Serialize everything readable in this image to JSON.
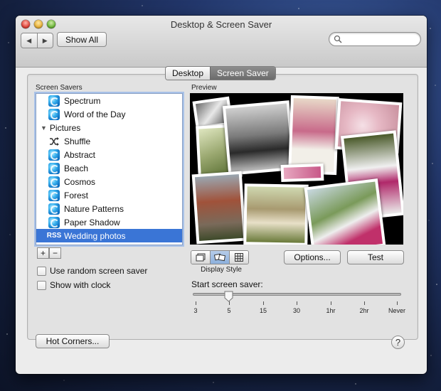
{
  "window": {
    "title": "Desktop & Screen Saver"
  },
  "toolbar": {
    "back": "◀",
    "forward": "▶",
    "show_all": "Show All",
    "search_placeholder": ""
  },
  "tabs": [
    {
      "label": "Desktop"
    },
    {
      "label": "Screen Saver",
      "selected": true
    }
  ],
  "screen_savers": {
    "label": "Screen Savers",
    "items": [
      {
        "label": "Spectrum",
        "icon": "screensaver-icon"
      },
      {
        "label": "Word of the Day",
        "icon": "screensaver-icon"
      },
      {
        "label": "Pictures",
        "icon": "disclosure-triangle-icon",
        "group": true
      },
      {
        "label": "Shuffle",
        "icon": "shuffle-icon"
      },
      {
        "label": "Abstract",
        "icon": "screensaver-icon"
      },
      {
        "label": "Beach",
        "icon": "screensaver-icon"
      },
      {
        "label": "Cosmos",
        "icon": "screensaver-icon"
      },
      {
        "label": "Forest",
        "icon": "screensaver-icon"
      },
      {
        "label": "Nature Patterns",
        "icon": "screensaver-icon"
      },
      {
        "label": "Paper Shadow",
        "icon": "screensaver-icon"
      },
      {
        "label": "Wedding photos",
        "icon": "rss-icon",
        "icon_text": "RSS",
        "selected": true
      }
    ],
    "add": "+",
    "remove": "−"
  },
  "options": {
    "use_random": "Use random screen saver",
    "show_clock": "Show with clock"
  },
  "preview": {
    "label": "Preview"
  },
  "display_style": {
    "label": "Display Style",
    "selected_index": 1
  },
  "buttons": {
    "options": "Options...",
    "test": "Test",
    "hot_corners": "Hot Corners...",
    "help": "?"
  },
  "slider": {
    "label": "Start screen saver:",
    "ticks": [
      "3",
      "5",
      "15",
      "30",
      "1hr",
      "2hr",
      "Never"
    ],
    "value": "5"
  },
  "colors": {
    "selection": "#3a75d6",
    "accent_blue": "#0a6fc2"
  }
}
